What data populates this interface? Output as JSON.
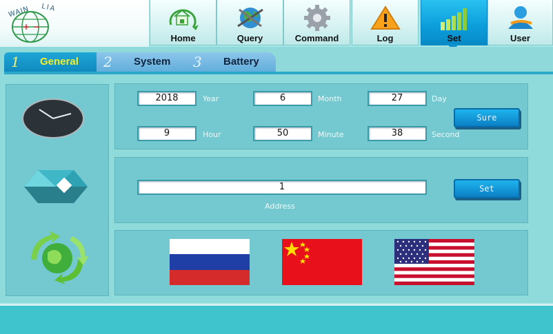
{
  "logo": {
    "text_left": "WAIN",
    "text_right": "LIA"
  },
  "nav": {
    "home": "Home",
    "query": "Query",
    "command": "Command",
    "log": "Log",
    "set": "Set",
    "user": "User",
    "active": "set"
  },
  "tabs": [
    {
      "num": "1",
      "label": "General"
    },
    {
      "num": "2",
      "label": "System"
    },
    {
      "num": "3",
      "label": "Battery"
    }
  ],
  "datetime": {
    "year": {
      "value": "2018",
      "label": "Year"
    },
    "month": {
      "value": "6",
      "label": "Month"
    },
    "day": {
      "value": "27",
      "label": "Day"
    },
    "hour": {
      "value": "9",
      "label": "Hour"
    },
    "minute": {
      "value": "50",
      "label": "Minute"
    },
    "second": {
      "value": "38",
      "label": "Second"
    },
    "sure_button": "Sure"
  },
  "address": {
    "value": "1",
    "label": "Address",
    "set_button": "Set"
  },
  "languages": [
    "russian-flag",
    "chinese-flag",
    "usa-flag"
  ],
  "colors": {
    "active_tab": "#1089bf",
    "active_nav": "#0b9ddb",
    "panel": "#74c8cf"
  }
}
